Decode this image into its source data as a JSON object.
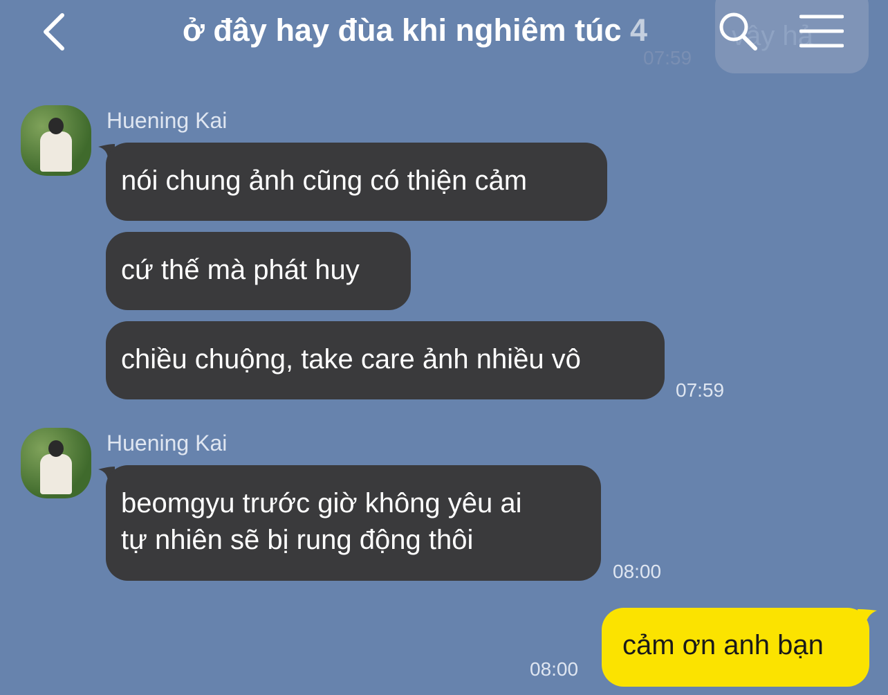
{
  "header": {
    "title": "ở đây hay đùa khi nghiêm túc",
    "member_count": "4",
    "ghost_preview_text": "vậy hả",
    "ghost_time": "07:59"
  },
  "icons": {
    "back": "chevron-left-icon",
    "search": "search-icon",
    "menu": "menu-icon"
  },
  "colors": {
    "background": "#6783ad",
    "incoming_bubble": "#3a3a3c",
    "outgoing_bubble": "#fbe300"
  },
  "groups": [
    {
      "sender": "Huening Kai",
      "messages": [
        "nói chung ảnh cũng có thiện cảm",
        "cứ thế mà phát huy",
        "chiều chuộng, take care ảnh nhiều vô"
      ],
      "time": "07:59"
    },
    {
      "sender": "Huening Kai",
      "messages": [
        "beomgyu trước giờ không yêu ai",
        "tự nhiên sẽ bị rung động thôi"
      ],
      "time": "08:00"
    }
  ],
  "outgoing": {
    "text": "cảm ơn anh bạn",
    "time": "08:00"
  }
}
